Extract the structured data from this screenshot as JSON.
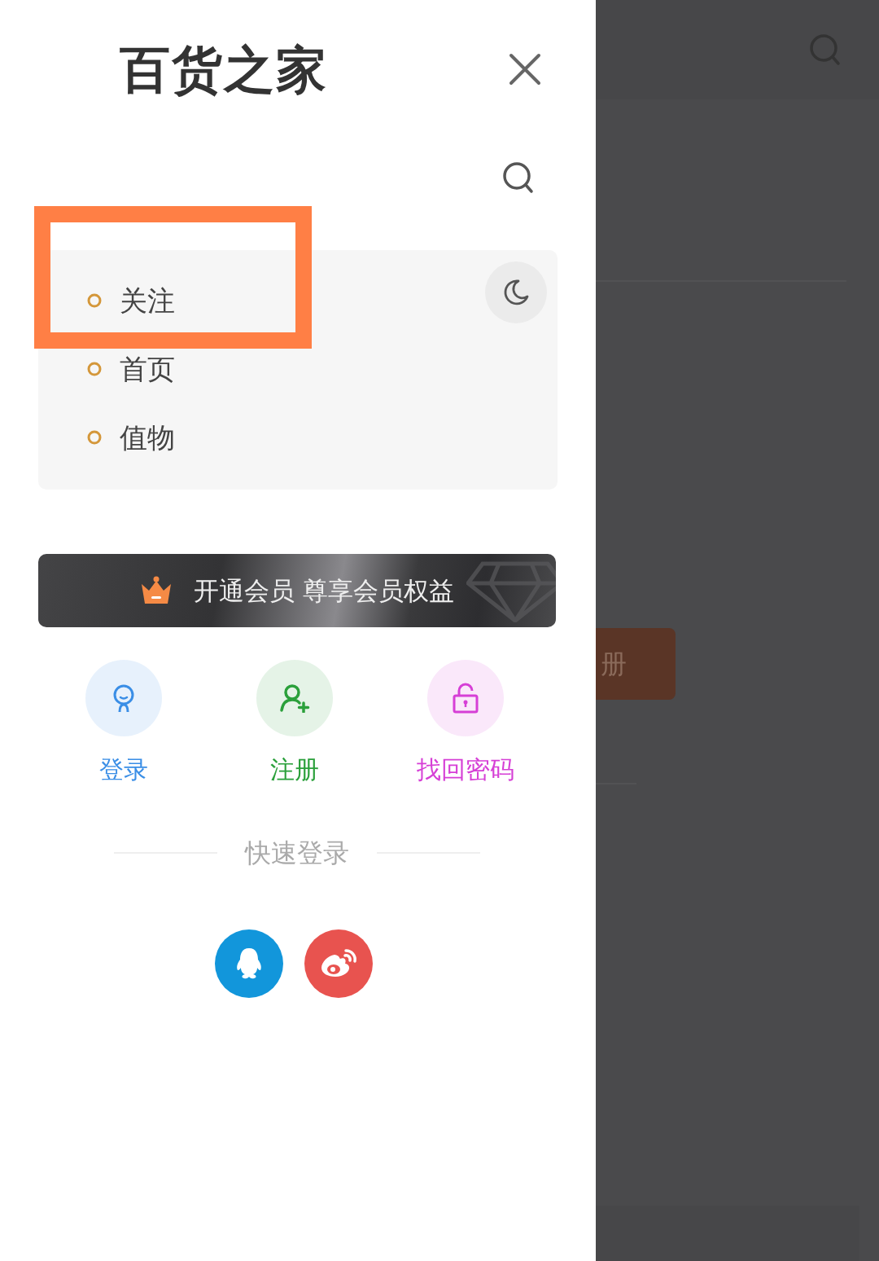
{
  "logo": "百货之家",
  "menu": [
    {
      "label": "关注",
      "highlighted": true
    },
    {
      "label": "首页",
      "highlighted": false
    },
    {
      "label": "值物",
      "highlighted": false
    }
  ],
  "vip_banner": "开通会员 尊享会员权益",
  "account_actions": [
    {
      "kind": "login",
      "label": "登录",
      "color": "#3a8ee6"
    },
    {
      "kind": "register",
      "label": "注册",
      "color": "#2ba03b"
    },
    {
      "kind": "recover",
      "label": "找回密码",
      "color": "#d63fd6"
    }
  ],
  "quick_login_title": "快速登录",
  "quick_login": [
    {
      "kind": "qq",
      "color": "#1296db"
    },
    {
      "kind": "weibo",
      "color": "#e8534f"
    }
  ],
  "background_page": {
    "button_label": "册"
  }
}
